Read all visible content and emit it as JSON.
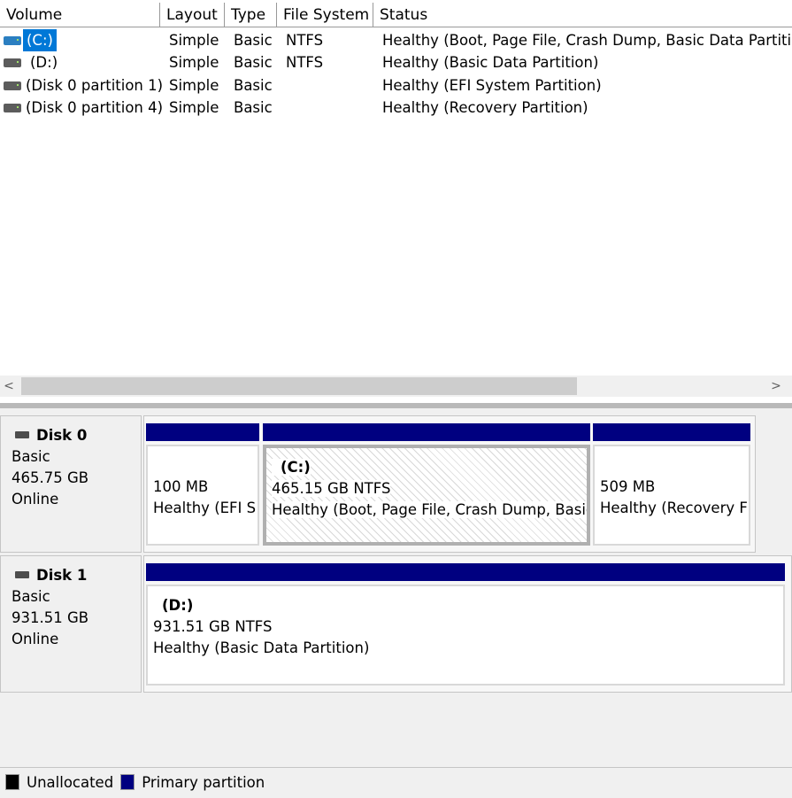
{
  "columns": [
    "Volume",
    "Layout",
    "Type",
    "File System",
    "Status"
  ],
  "volumes": [
    {
      "name": "(C:)",
      "layout": "Simple",
      "type": "Basic",
      "fs": "NTFS",
      "status": "Healthy (Boot, Page File, Crash Dump, Basic Data Partition)",
      "icon": "drive-blue-icon"
    },
    {
      "name": "(D:)",
      "layout": "Simple",
      "type": "Basic",
      "fs": "NTFS",
      "status": "Healthy (Basic Data Partition)",
      "icon": "drive-gray-icon"
    },
    {
      "name": "(Disk 0 partition 1)",
      "layout": "Simple",
      "type": "Basic",
      "fs": "",
      "status": "Healthy (EFI System Partition)",
      "icon": "drive-gray-icon"
    },
    {
      "name": "(Disk 0 partition 4)",
      "layout": "Simple",
      "type": "Basic",
      "fs": "",
      "status": "Healthy (Recovery Partition)",
      "icon": "drive-gray-icon"
    }
  ],
  "disks": [
    {
      "name": "Disk 0",
      "type": "Basic",
      "size": "465.75 GB",
      "state": "Online",
      "partitions": [
        {
          "title": "",
          "size": "100 MB",
          "status": "Healthy (EFI S"
        },
        {
          "title": "(C:)",
          "size": "465.15 GB NTFS",
          "status": "Healthy (Boot, Page File, Crash Dump, Basic"
        },
        {
          "title": "",
          "size": "509 MB",
          "status": "Healthy (Recovery F"
        }
      ]
    },
    {
      "name": "Disk 1",
      "type": "Basic",
      "size": "931.51 GB",
      "state": "Online",
      "partitions": [
        {
          "title": "(D:)",
          "size": "931.51 GB NTFS",
          "status": "Healthy (Basic Data Partition)"
        }
      ]
    }
  ],
  "legend": [
    {
      "label": "Unallocated",
      "color": "#000000"
    },
    {
      "label": "Primary partition",
      "color": "#000080"
    }
  ],
  "scroll": {
    "left": "<",
    "right": ">"
  }
}
